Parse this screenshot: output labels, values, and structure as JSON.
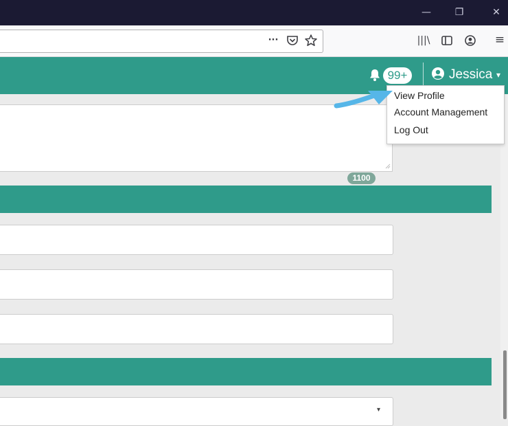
{
  "window": {
    "minimize_glyph": "—",
    "restore_glyph": "❐",
    "close_glyph": "✕"
  },
  "browser": {
    "page_actions_glyph": "···",
    "library_glyph": "|||\\",
    "menu_glyph": "≡"
  },
  "header": {
    "notification_count": "99+",
    "user_name": "Jessica",
    "caret": "▾"
  },
  "user_menu": {
    "items": [
      "View Profile",
      "Account Management",
      "Log Out"
    ]
  },
  "content": {
    "character_count": "1100",
    "select_caret": "▾"
  },
  "colors": {
    "accent": "#2f9b8a",
    "titlebar": "#1b1a33",
    "annotation_arrow": "#56b6e8"
  },
  "icons": [
    "bell-icon",
    "user-circle-icon",
    "pocket-icon",
    "bookmark-star-icon",
    "library-icon",
    "sidebar-icon",
    "account-icon",
    "hamburger-menu-icon"
  ]
}
